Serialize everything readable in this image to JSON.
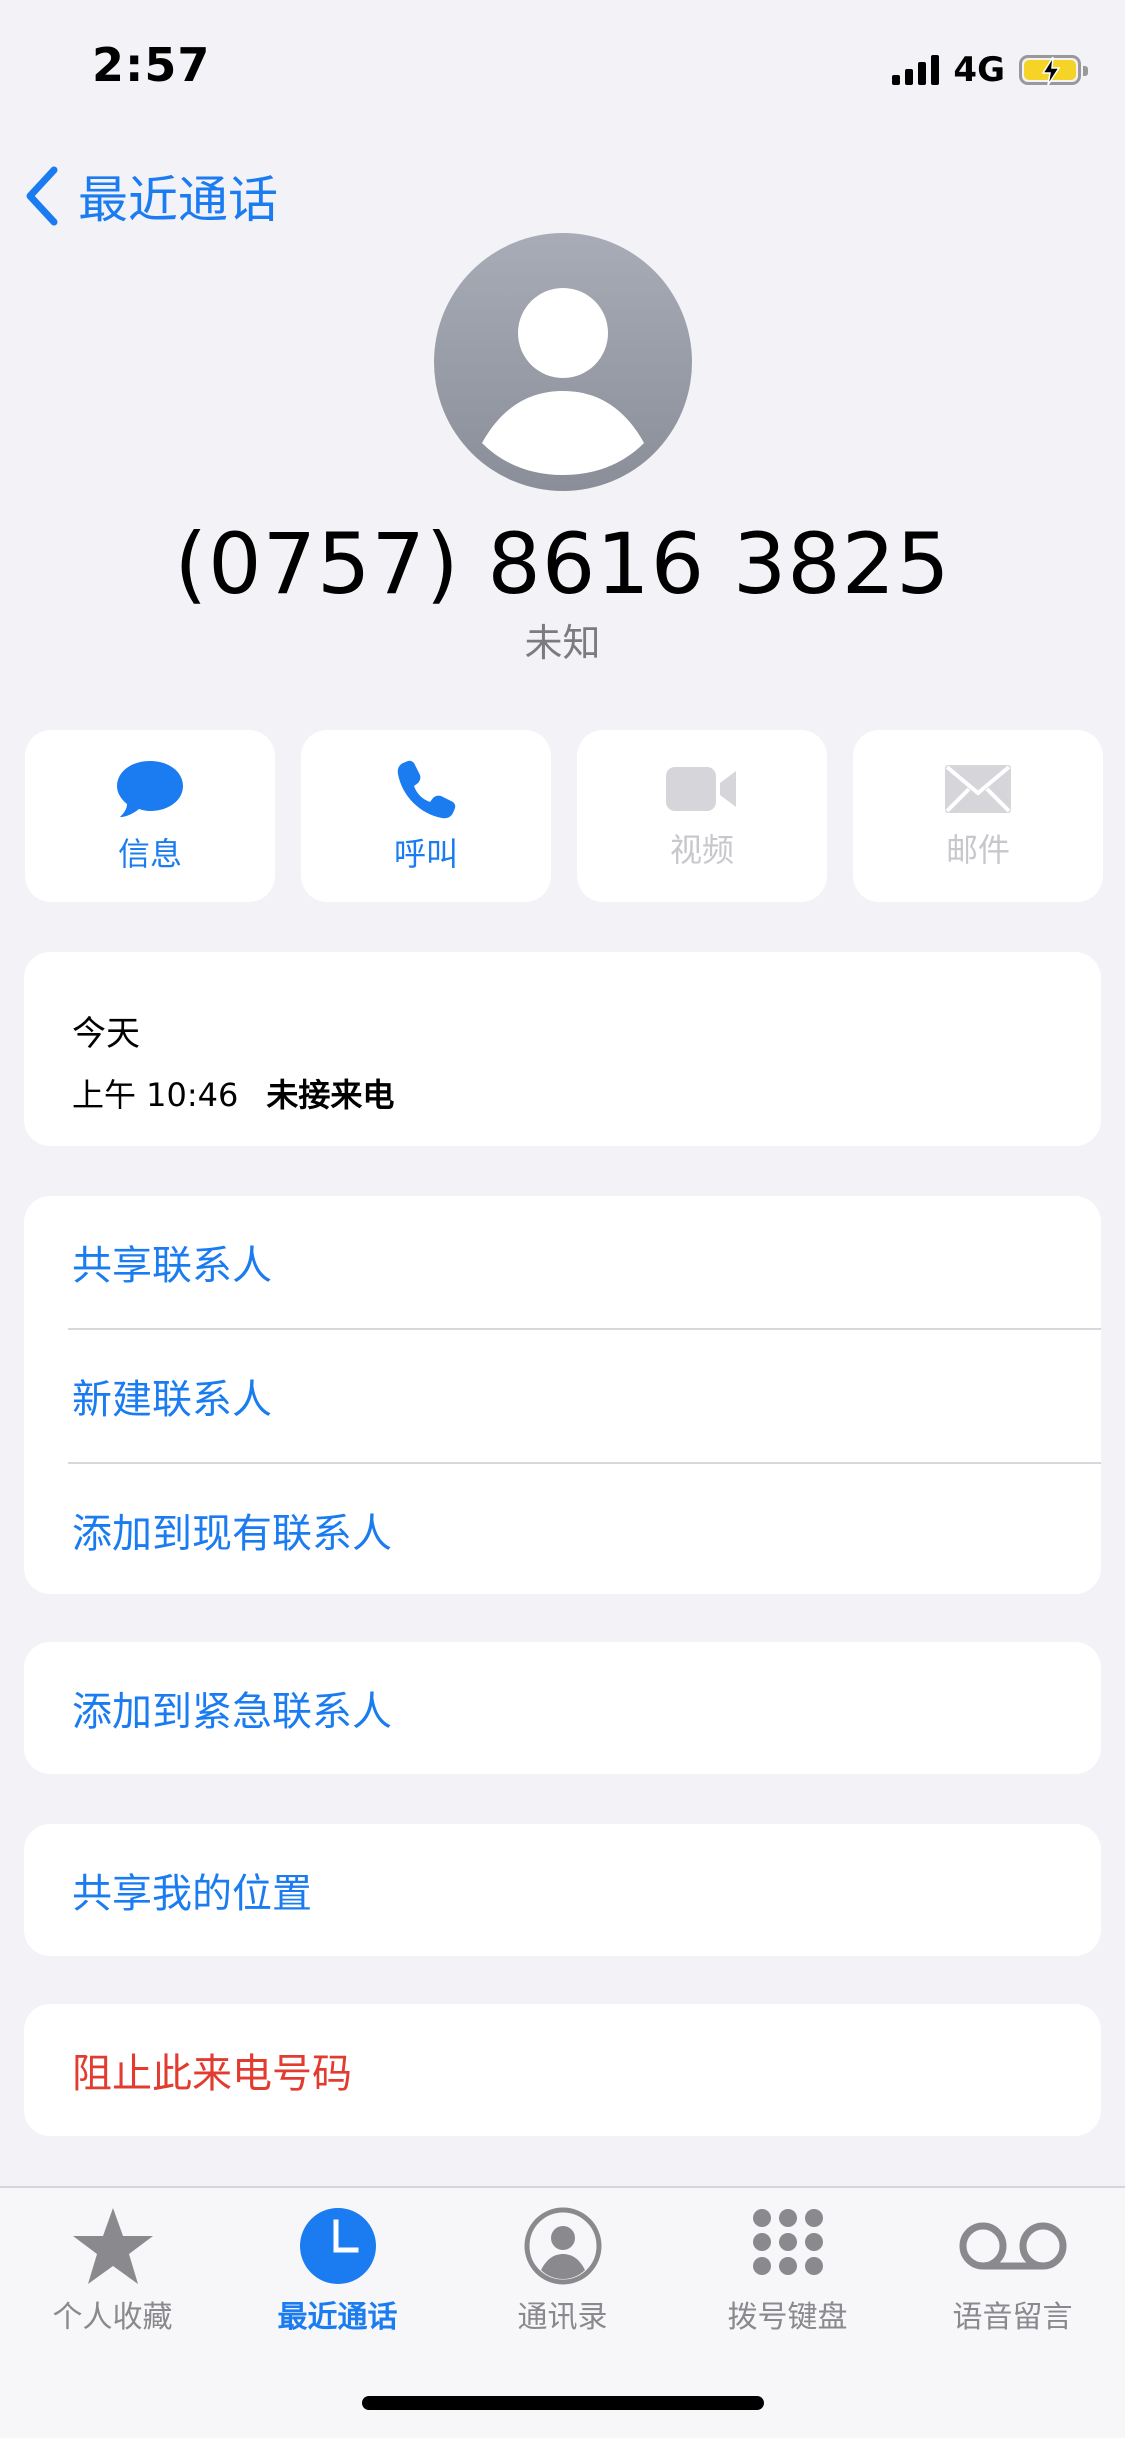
{
  "status_bar": {
    "time": "2:57",
    "network": "4G",
    "battery_charging": true
  },
  "nav": {
    "back_label": "最近通话"
  },
  "contact": {
    "phone_number": "(0757) 8616 3825",
    "subtitle": "未知"
  },
  "actions": [
    {
      "label": "信息",
      "icon": "message-bubble-icon",
      "enabled": true
    },
    {
      "label": "呼叫",
      "icon": "phone-icon",
      "enabled": true
    },
    {
      "label": "视频",
      "icon": "video-camera-icon",
      "enabled": false
    },
    {
      "label": "邮件",
      "icon": "envelope-icon",
      "enabled": false
    }
  ],
  "recent_call": {
    "date": "今天",
    "time": "上午 10:46",
    "status": "未接来电"
  },
  "options": [
    {
      "label": "共享联系人"
    },
    {
      "label": "新建联系人"
    },
    {
      "label": "添加到现有联系人"
    }
  ],
  "emergency": {
    "label": "添加到紧急联系人"
  },
  "location": {
    "label": "共享我的位置"
  },
  "block": {
    "label": "阻止此来电号码"
  },
  "tabs": [
    {
      "label": "个人收藏",
      "icon": "star-icon",
      "selected": false
    },
    {
      "label": "最近通话",
      "icon": "clock-icon",
      "selected": true
    },
    {
      "label": "通讯录",
      "icon": "contacts-person-icon",
      "selected": false
    },
    {
      "label": "拨号键盘",
      "icon": "keypad-icon",
      "selected": false
    },
    {
      "label": "语音留言",
      "icon": "voicemail-icon",
      "selected": false
    }
  ],
  "colors": {
    "accent": "#1a7cf0",
    "destructive": "#e23c30",
    "background": "#f2f2f7",
    "disabled": "#c7c7cc"
  }
}
